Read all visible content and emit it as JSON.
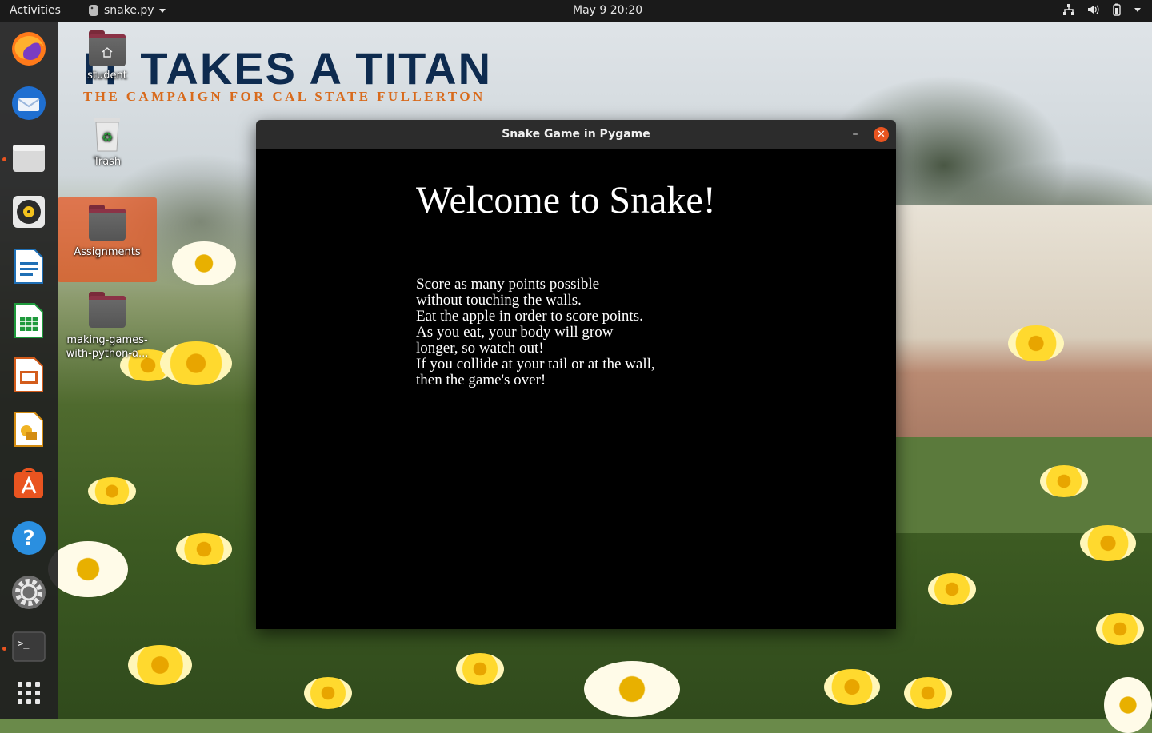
{
  "topbar": {
    "activities": "Activities",
    "app_name": "snake.py",
    "clock": "May 9  20:20",
    "tray_icons": [
      "network-icon",
      "volume-icon",
      "battery-icon",
      "system-menu-caret"
    ]
  },
  "dock": {
    "items": [
      "firefox",
      "thunderbird",
      "files",
      "rhythmbox",
      "libreoffice-writer",
      "libreoffice-calc",
      "libreoffice-impress",
      "libreoffice-draw",
      "ubuntu-software",
      "help",
      "settings",
      "terminal",
      "show-applications"
    ]
  },
  "banner": {
    "title": "IT TAKES A TITAN",
    "subtitle": "THE CAMPAIGN FOR CAL STATE FULLERTON"
  },
  "desktop": {
    "home_label": "student",
    "trash_label": "Trash",
    "assignments_label": "Assignments",
    "making_games_label_1": "making-games-",
    "making_games_label_2": "with-python-a..."
  },
  "window": {
    "title": "Snake Game in Pygame",
    "minimize": "–",
    "close": "✕"
  },
  "game": {
    "heading": "Welcome to Snake!",
    "lines": [
      "Score as many points possible",
      "without touching the walls.",
      "Eat the apple in order to score points.",
      "As you eat, your body will grow",
      "longer, so watch out!",
      "If you collide at your tail or at the wall,",
      "then the game's over!"
    ]
  },
  "colors": {
    "accent": "#e95420",
    "banner_blue": "#0e2b4f",
    "banner_orange": "#d86a1c"
  }
}
